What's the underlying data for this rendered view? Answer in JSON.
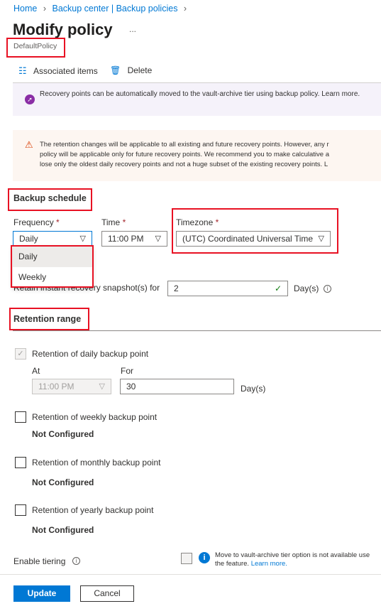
{
  "breadcrumb": {
    "items": [
      "Home",
      "Backup center | Backup policies"
    ]
  },
  "header": {
    "title": "Modify policy",
    "more": "...",
    "subtitle": "DefaultPolicy"
  },
  "toolbar": {
    "associated_items": "Associated items",
    "delete": "Delete"
  },
  "banners": {
    "tiering_info": "Recovery points can be automatically moved to the vault-archive tier using backup policy. Learn more.",
    "retention_warning": [
      "The retention changes will be applicable to all existing and future recovery points. However, any r",
      "policy will be applicable only for future recovery points. We recommend you to make calculative a",
      "lose only the oldest daily recovery points and not a huge subset of the existing recovery points. L"
    ]
  },
  "schedule": {
    "heading": "Backup schedule",
    "frequency_label": "Frequency",
    "frequency_value": "Daily",
    "frequency_options": [
      "Daily",
      "Weekly"
    ],
    "time_label": "Time",
    "time_value": "11:00 PM",
    "timezone_label": "Timezone",
    "timezone_value": "(UTC) Coordinated Universal Time",
    "required": "*",
    "snapshot_label": "Retain instant recovery snapshot(s) for",
    "snapshot_value": "2",
    "snapshot_unit": "Day(s)"
  },
  "retention": {
    "heading": "Retention range",
    "daily_label": "Retention of daily backup point",
    "daily_checked": true,
    "at_label": "At",
    "at_value": "11:00 PM",
    "for_label": "For",
    "for_value": "30",
    "for_unit": "Day(s)",
    "weekly_label": "Retention of weekly backup point",
    "monthly_label": "Retention of monthly backup point",
    "yearly_label": "Retention of yearly backup point",
    "not_configured": "Not Configured"
  },
  "tiering": {
    "label": "Enable tiering",
    "message_line1": "Move to vault-archive tier option is not available",
    "message_line2": "use the feature.",
    "learn_more": "Learn more."
  },
  "footer": {
    "update": "Update",
    "cancel": "Cancel"
  },
  "colors": {
    "accent": "#0078d4",
    "highlight": "#e81123",
    "purple": "#8a2da5",
    "warning": "#d83b01"
  }
}
